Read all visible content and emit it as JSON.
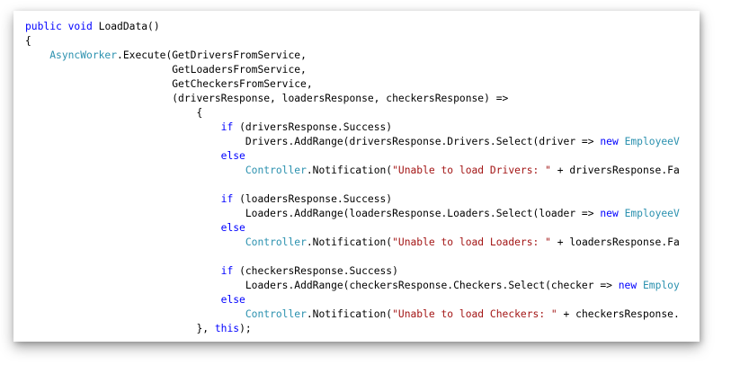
{
  "code_lines": [
    {
      "indent": 0,
      "segments": [
        {
          "t": "kw",
          "v": "public"
        },
        {
          "t": "p",
          "v": " "
        },
        {
          "t": "kw",
          "v": "void"
        },
        {
          "t": "p",
          "v": " LoadData()"
        }
      ]
    },
    {
      "indent": 0,
      "segments": [
        {
          "t": "p",
          "v": "{"
        }
      ]
    },
    {
      "indent": 4,
      "segments": [
        {
          "t": "ty",
          "v": "AsyncWorker"
        },
        {
          "t": "p",
          "v": ".Execute(GetDriversFromService,"
        }
      ]
    },
    {
      "indent": 24,
      "segments": [
        {
          "t": "p",
          "v": "GetLoadersFromService,"
        }
      ]
    },
    {
      "indent": 24,
      "segments": [
        {
          "t": "p",
          "v": "GetCheckersFromService,"
        }
      ]
    },
    {
      "indent": 24,
      "segments": [
        {
          "t": "p",
          "v": "(driversResponse, loadersResponse, checkersResponse) =>"
        }
      ]
    },
    {
      "indent": 28,
      "segments": [
        {
          "t": "p",
          "v": "{"
        }
      ]
    },
    {
      "indent": 32,
      "segments": [
        {
          "t": "kw",
          "v": "if"
        },
        {
          "t": "p",
          "v": " (driversResponse.Success)"
        }
      ]
    },
    {
      "indent": 36,
      "segments": [
        {
          "t": "p",
          "v": "Drivers.AddRange(driversResponse.Drivers.Select(driver => "
        },
        {
          "t": "kw",
          "v": "new"
        },
        {
          "t": "p",
          "v": " "
        },
        {
          "t": "ty",
          "v": "EmployeeV"
        }
      ]
    },
    {
      "indent": 32,
      "segments": [
        {
          "t": "kw",
          "v": "else"
        }
      ]
    },
    {
      "indent": 36,
      "segments": [
        {
          "t": "ty",
          "v": "Controller"
        },
        {
          "t": "p",
          "v": ".Notification("
        },
        {
          "t": "st",
          "v": "\"Unable to load Drivers: \""
        },
        {
          "t": "p",
          "v": " + driversResponse.Fa"
        }
      ]
    },
    {
      "indent": 0,
      "segments": []
    },
    {
      "indent": 32,
      "segments": [
        {
          "t": "kw",
          "v": "if"
        },
        {
          "t": "p",
          "v": " (loadersResponse.Success)"
        }
      ]
    },
    {
      "indent": 36,
      "segments": [
        {
          "t": "p",
          "v": "Loaders.AddRange(loadersResponse.Loaders.Select(loader => "
        },
        {
          "t": "kw",
          "v": "new"
        },
        {
          "t": "p",
          "v": " "
        },
        {
          "t": "ty",
          "v": "EmployeeV"
        }
      ]
    },
    {
      "indent": 32,
      "segments": [
        {
          "t": "kw",
          "v": "else"
        }
      ]
    },
    {
      "indent": 36,
      "segments": [
        {
          "t": "ty",
          "v": "Controller"
        },
        {
          "t": "p",
          "v": ".Notification("
        },
        {
          "t": "st",
          "v": "\"Unable to load Loaders: \""
        },
        {
          "t": "p",
          "v": " + loadersResponse.Fa"
        }
      ]
    },
    {
      "indent": 0,
      "segments": []
    },
    {
      "indent": 32,
      "segments": [
        {
          "t": "kw",
          "v": "if"
        },
        {
          "t": "p",
          "v": " (checkersResponse.Success)"
        }
      ]
    },
    {
      "indent": 36,
      "segments": [
        {
          "t": "p",
          "v": "Loaders.AddRange(checkersResponse.Checkers.Select(checker => "
        },
        {
          "t": "kw",
          "v": "new"
        },
        {
          "t": "p",
          "v": " "
        },
        {
          "t": "ty",
          "v": "Employ"
        }
      ]
    },
    {
      "indent": 32,
      "segments": [
        {
          "t": "kw",
          "v": "else"
        }
      ]
    },
    {
      "indent": 36,
      "segments": [
        {
          "t": "ty",
          "v": "Controller"
        },
        {
          "t": "p",
          "v": ".Notification("
        },
        {
          "t": "st",
          "v": "\"Unable to load Checkers: \""
        },
        {
          "t": "p",
          "v": " + checkersResponse."
        }
      ]
    },
    {
      "indent": 28,
      "segments": [
        {
          "t": "p",
          "v": "}, "
        },
        {
          "t": "kw",
          "v": "this"
        },
        {
          "t": "p",
          "v": ");"
        }
      ]
    }
  ],
  "colors": {
    "keyword": "#0000ff",
    "type": "#2b91af",
    "string": "#a31515",
    "plain": "#000000"
  }
}
